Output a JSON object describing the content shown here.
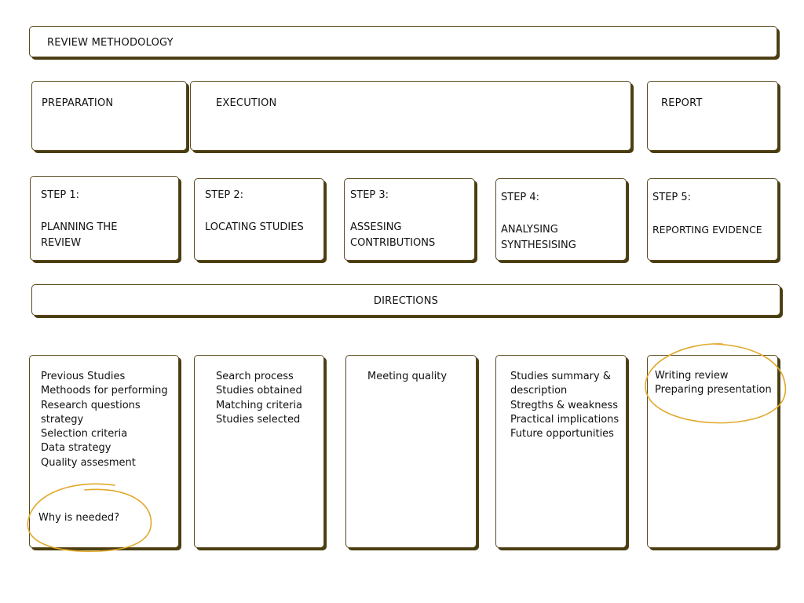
{
  "title": "REVIEW METHODOLOGY",
  "phases": {
    "preparation": "PREPARATION",
    "execution": "EXECUTION",
    "report": "REPORT"
  },
  "steps": [
    {
      "label": "STEP 1:",
      "name": "PLANNING THE REVIEW"
    },
    {
      "label": "STEP 2:",
      "name": "LOCATING STUDIES"
    },
    {
      "label": "STEP 3:",
      "name": "ASSESING CONTRIBUTIONS"
    },
    {
      "label": "STEP 4:",
      "name": "ANALYSING SYNTHESISING"
    },
    {
      "label": "STEP 5:",
      "name": "REPORTING EVIDENCE"
    }
  ],
  "directions": "DIRECTIONS",
  "details": [
    {
      "items": [
        "Previous Studies",
        "Methoods for performing",
        "Research questions strategy",
        "Selection criteria",
        "Data strategy",
        "Quality assesment"
      ],
      "note": "Why is needed?"
    },
    {
      "items": [
        "Search process",
        "Studies obtained",
        "Matching criteria",
        "Studies selected"
      ]
    },
    {
      "items": [
        "Meeting quality"
      ]
    },
    {
      "items": [
        "Studies summary & description",
        "Stregths & weakness",
        "Practical implications",
        "Future opportunities"
      ]
    },
    {
      "items": [
        "Writing review",
        "Preparing presentation"
      ]
    }
  ],
  "colors": {
    "border": "#5a4a1e",
    "shadow": "#4a3d12",
    "highlight": "#e0a92a"
  }
}
